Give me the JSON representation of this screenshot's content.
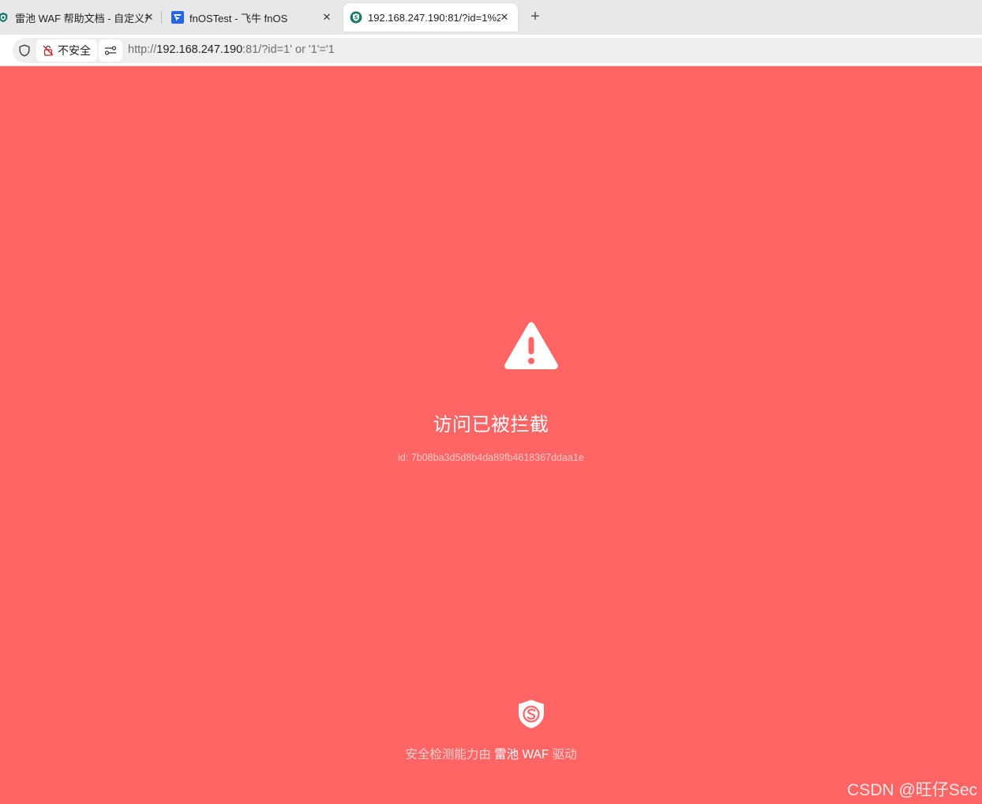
{
  "tabs": [
    {
      "title": "雷池 WAF 帮助文档 - 自定义规",
      "close": "✕",
      "icon": "safeline-shield-icon"
    },
    {
      "title": "fnOSTest - 飞牛 fnOS",
      "close": "✕",
      "icon": "fnos-icon"
    },
    {
      "title": "192.168.247.190:81/?id=1%2",
      "close": "✕",
      "icon": "safeline-shield-icon",
      "active": true
    }
  ],
  "new_tab": "+",
  "address_bar": {
    "security_label": "不安全",
    "url_scheme": "http://",
    "url_host": "192.168.247.190",
    "url_rest": ":81/?id=1' or '1'='1"
  },
  "block_page": {
    "title": "访问已被拦截",
    "event_id": "id: 7b08ba3d5d8b4da89fb4618367ddaa1e",
    "powered_prefix": "安全检测能力由",
    "powered_brand": "雷池 WAF",
    "powered_suffix": "驱动",
    "background_color": "#ff6565"
  },
  "watermark": "CSDN @旺仔Sec"
}
